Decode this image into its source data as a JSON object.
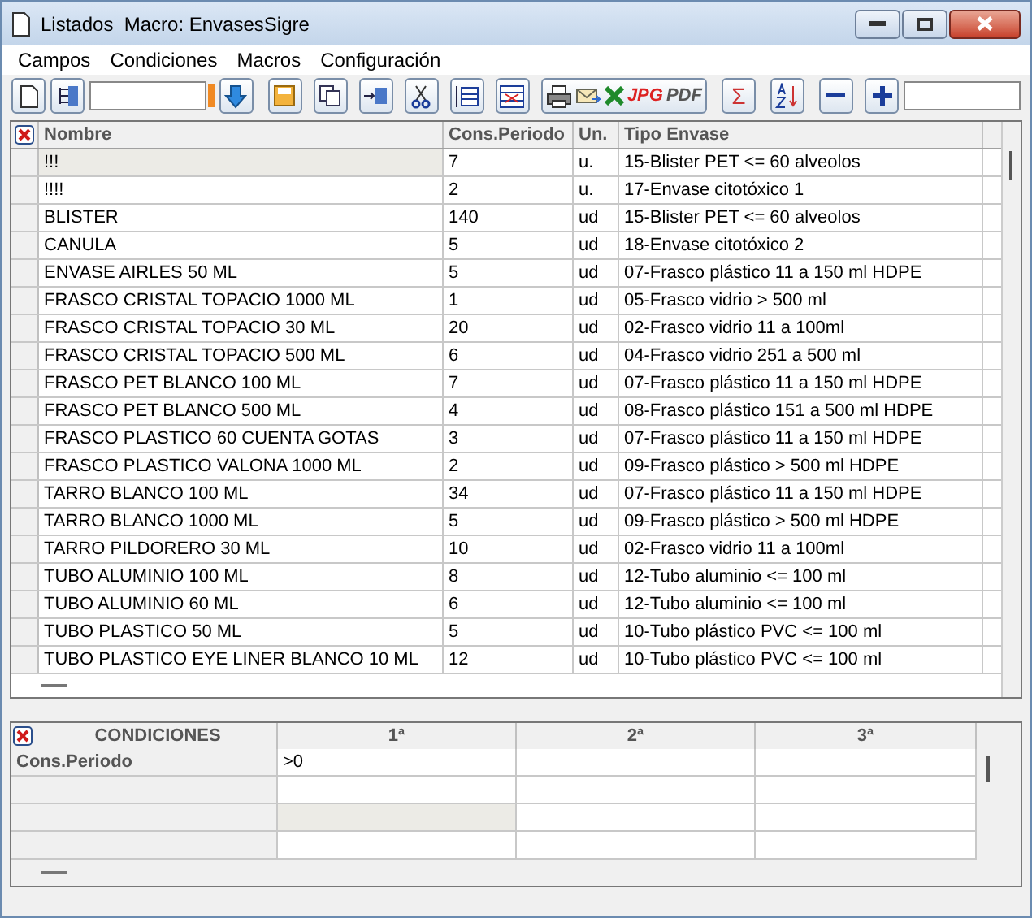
{
  "window": {
    "title": "Listados  Macro: EnvasesSigre"
  },
  "menu": [
    "Campos",
    "Condiciones",
    "Macros",
    "Configuración"
  ],
  "toolbar": {
    "export_labels": [
      "JPG",
      "PDF"
    ],
    "sum_symbol": "Σ"
  },
  "table": {
    "columns": [
      "Nombre",
      "Cons.Periodo",
      "Un.",
      "Tipo Envase"
    ],
    "rows": [
      {
        "cells": [
          "!!!",
          "7",
          "u.",
          "15-Blister PET <= 60 alveolos"
        ],
        "selected": true
      },
      {
        "cells": [
          "!!!!",
          "2",
          "u.",
          "17-Envase citotóxico 1"
        ],
        "selected": false
      },
      {
        "cells": [
          "BLISTER",
          "140",
          "ud",
          "15-Blister PET <= 60 alveolos"
        ],
        "selected": false
      },
      {
        "cells": [
          "CANULA",
          "5",
          "ud",
          "18-Envase citotóxico 2"
        ],
        "selected": false
      },
      {
        "cells": [
          "ENVASE AIRLES 50 ML",
          "5",
          "ud",
          "07-Frasco plástico 11 a 150 ml HDPE"
        ],
        "selected": false
      },
      {
        "cells": [
          "FRASCO CRISTAL TOPACIO 1000 ML",
          "1",
          "ud",
          "05-Frasco vidrio > 500 ml"
        ],
        "selected": false
      },
      {
        "cells": [
          "FRASCO CRISTAL TOPACIO 30 ML",
          "20",
          "ud",
          "02-Frasco vidrio 11 a 100ml"
        ],
        "selected": false
      },
      {
        "cells": [
          "FRASCO CRISTAL TOPACIO 500 ML",
          "6",
          "ud",
          "04-Frasco vidrio 251 a 500 ml"
        ],
        "selected": false
      },
      {
        "cells": [
          "FRASCO PET BLANCO 100 ML",
          "7",
          "ud",
          "07-Frasco plástico 11 a 150 ml HDPE"
        ],
        "selected": false
      },
      {
        "cells": [
          "FRASCO PET BLANCO 500 ML",
          "4",
          "ud",
          "08-Frasco plástico 151 a 500 ml HDPE"
        ],
        "selected": false
      },
      {
        "cells": [
          "FRASCO PLASTICO 60 CUENTA GOTAS",
          "3",
          "ud",
          "07-Frasco plástico 11 a 150 ml HDPE"
        ],
        "selected": false
      },
      {
        "cells": [
          "FRASCO PLASTICO VALONA 1000 ML",
          "2",
          "ud",
          "09-Frasco plástico > 500 ml HDPE"
        ],
        "selected": false
      },
      {
        "cells": [
          "TARRO BLANCO 100 ML",
          "34",
          "ud",
          "07-Frasco plástico 11 a 150 ml HDPE"
        ],
        "selected": false
      },
      {
        "cells": [
          "TARRO BLANCO 1000 ML",
          "5",
          "ud",
          "09-Frasco plástico > 500 ml HDPE"
        ],
        "selected": false
      },
      {
        "cells": [
          "TARRO PILDORERO 30 ML",
          "10",
          "ud",
          "02-Frasco vidrio 11 a 100ml"
        ],
        "selected": false
      },
      {
        "cells": [
          "TUBO ALUMINIO 100 ML",
          "8",
          "ud",
          "12-Tubo aluminio <= 100 ml"
        ],
        "selected": false
      },
      {
        "cells": [
          "TUBO ALUMINIO 60 ML",
          "6",
          "ud",
          "12-Tubo aluminio <= 100 ml"
        ],
        "selected": false
      },
      {
        "cells": [
          "TUBO PLASTICO 50 ML",
          "5",
          "ud",
          "10-Tubo plástico PVC <= 100 ml"
        ],
        "selected": false
      },
      {
        "cells": [
          "TUBO PLASTICO EYE LINER BLANCO 10 ML",
          "12",
          "ud",
          "10-Tubo plástico PVC <= 100 ml"
        ],
        "selected": false
      }
    ]
  },
  "conditions": {
    "columns": [
      "CONDICIONES",
      "1ª",
      "2ª",
      "3ª"
    ],
    "rows": [
      {
        "cells": [
          "Cons.Periodo",
          ">0",
          "",
          ""
        ]
      },
      {
        "cells": [
          "",
          "",
          "",
          ""
        ]
      },
      {
        "cells": [
          "",
          "",
          "",
          ""
        ]
      },
      {
        "cells": [
          "",
          "",
          "",
          ""
        ]
      }
    ]
  }
}
